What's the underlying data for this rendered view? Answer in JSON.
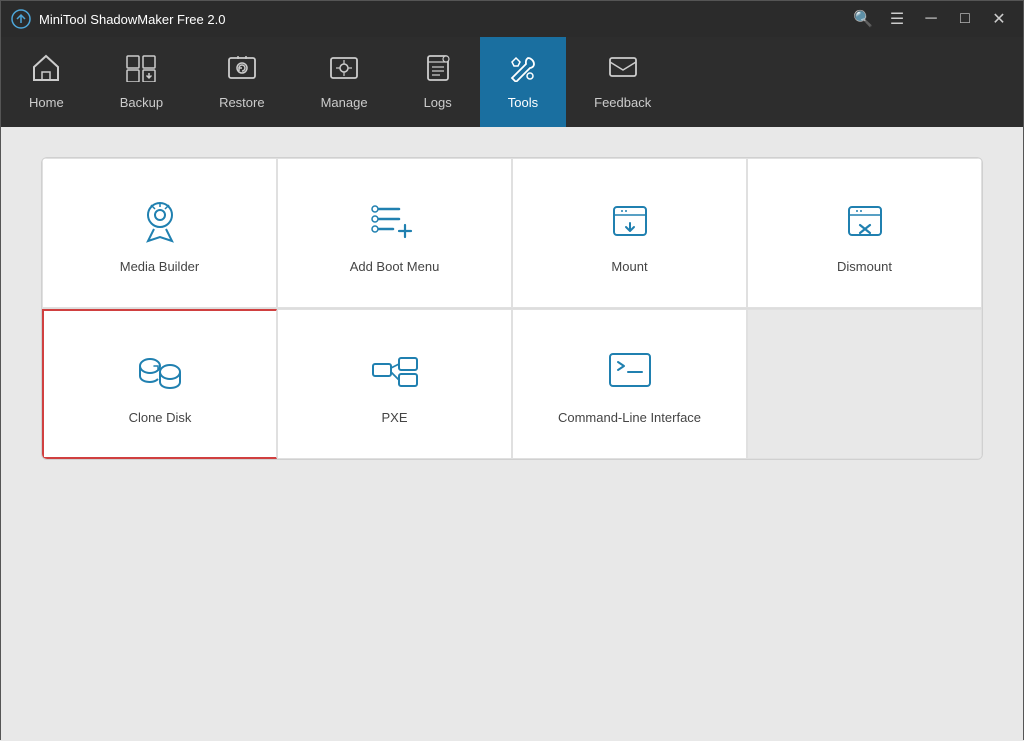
{
  "titleBar": {
    "title": "MiniTool ShadowMaker Free 2.0",
    "controls": {
      "search": "🔍",
      "menu": "☰",
      "minimize": "─",
      "restore": "□",
      "close": "✕"
    }
  },
  "nav": {
    "items": [
      {
        "id": "home",
        "label": "Home",
        "active": false
      },
      {
        "id": "backup",
        "label": "Backup",
        "active": false
      },
      {
        "id": "restore",
        "label": "Restore",
        "active": false
      },
      {
        "id": "manage",
        "label": "Manage",
        "active": false
      },
      {
        "id": "logs",
        "label": "Logs",
        "active": false
      },
      {
        "id": "tools",
        "label": "Tools",
        "active": true
      },
      {
        "id": "feedback",
        "label": "Feedback",
        "active": false
      }
    ]
  },
  "tools": {
    "row1": [
      {
        "id": "media-builder",
        "label": "Media Builder"
      },
      {
        "id": "add-boot-menu",
        "label": "Add Boot Menu"
      },
      {
        "id": "mount",
        "label": "Mount"
      },
      {
        "id": "dismount",
        "label": "Dismount"
      }
    ],
    "row2": [
      {
        "id": "clone-disk",
        "label": "Clone Disk",
        "selected": true
      },
      {
        "id": "pxe",
        "label": "PXE"
      },
      {
        "id": "cli",
        "label": "Command-Line Interface"
      },
      {
        "id": "empty",
        "label": ""
      }
    ]
  }
}
